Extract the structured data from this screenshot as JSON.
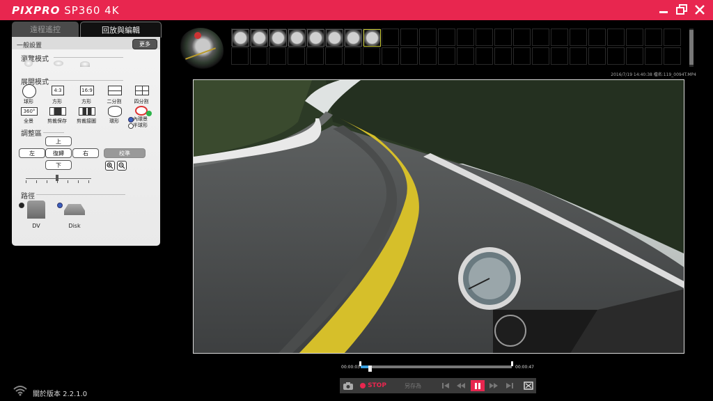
{
  "app": {
    "brand_part1": "PIXPRO",
    "brand_part2": " SP360 4K"
  },
  "colors": {
    "accent": "#e8264f",
    "progress": "#3aa0e0"
  },
  "tabs": [
    {
      "label": "遠程遙控"
    },
    {
      "label": "回放與編輯"
    }
  ],
  "panel": {
    "general_settings": "一般設置",
    "more_button": "更多",
    "browse_mode": "瀏覽模式",
    "unfold_mode": "展開模式",
    "modes": [
      {
        "label": "球形",
        "icon": "sphere-icon"
      },
      {
        "label": "方形",
        "icon_text": "4:3"
      },
      {
        "label": "方形",
        "icon_text": "16:9"
      },
      {
        "label": "二分割",
        "icon": "split2-icon"
      },
      {
        "label": "四分割",
        "icon": "split4-icon"
      },
      {
        "label": "全景",
        "icon_text": "360°"
      },
      {
        "label": "剪裁保存",
        "icon": "crop-save-icon"
      },
      {
        "label": "剪裁接圖",
        "icon": "crop-stitch-icon"
      },
      {
        "label": "環形",
        "icon": "ring-icon"
      }
    ],
    "dome_options": [
      "內環景",
      "半球形"
    ],
    "adjust_area": "調整區",
    "dir_up": "上",
    "dir_left": "左",
    "dir_reset": "復歸",
    "dir_right": "右",
    "dir_down": "下",
    "calibrate": "校準",
    "path": "路徑",
    "path_options": [
      "DV",
      "Disk"
    ]
  },
  "file_info": "2016/7/19 14:40:38 檔名:119_0094T.MP4",
  "playback": {
    "current_time": "00:00:03",
    "total_time": "00:00:47",
    "progress": 0.06,
    "stop_label": "STOP",
    "save_as_label": "另存為"
  },
  "footer": {
    "version_label": "關於版本 2.2.1.0"
  }
}
